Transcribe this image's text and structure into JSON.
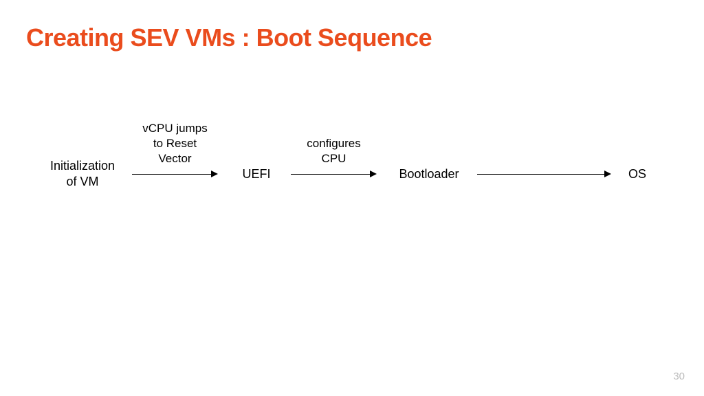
{
  "title": "Creating SEV VMs : Boot Sequence",
  "diagram": {
    "nodes": {
      "init": "Initialization\nof VM",
      "uefi": "UEFI",
      "bootloader": "Bootloader",
      "os": "OS"
    },
    "arrows": {
      "a1_label": "vCPU jumps\nto Reset\nVector",
      "a2_label": "configures\nCPU",
      "a3_label": ""
    }
  },
  "page_number": "30",
  "colors": {
    "title": "#EA4C1D"
  }
}
